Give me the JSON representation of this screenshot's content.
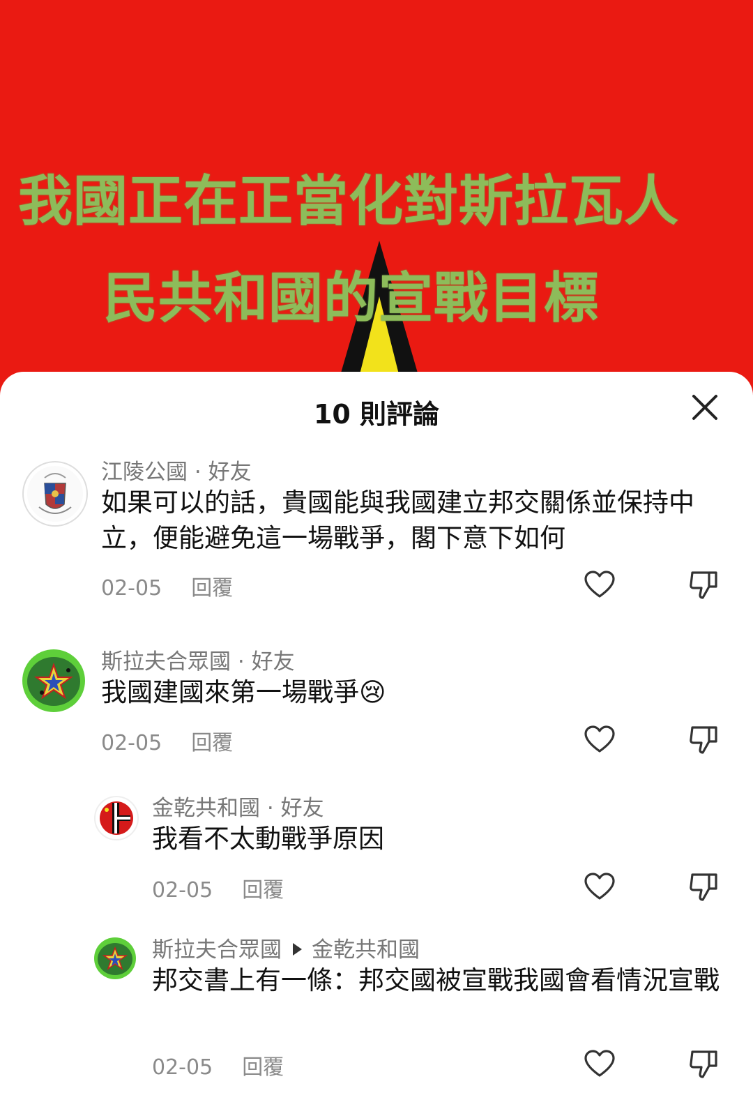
{
  "banner": {
    "line1": "我國正在正當化對斯拉瓦人",
    "line2": "民共和國的宣戰目標"
  },
  "sheet": {
    "title": "10 則評論"
  },
  "comments": [
    {
      "author": "江陵公國",
      "relation": "好友",
      "text": "如果可以的話，貴國能與我國建立邦交關係並保持中立，便能避免這一場戰爭，閣下意下如何",
      "date": "02-05",
      "reply_label": "回覆"
    },
    {
      "author": "斯拉夫合眾國",
      "relation": "好友",
      "text": "我國建國來第一場戰爭",
      "emoji": "😢",
      "date": "02-05",
      "reply_label": "回覆"
    },
    {
      "author": "金乾共和國",
      "relation": "好友",
      "text": "我看不太動戰爭原因",
      "date": "02-05",
      "reply_label": "回覆"
    },
    {
      "author": "斯拉夫合眾國",
      "reply_to": "金乾共和國",
      "text": "邦交書上有一條：邦交國被宣戰我國會看情況宣戰",
      "date": "02-05",
      "reply_label": "回覆"
    }
  ],
  "icons": {
    "close": "close-icon",
    "like": "heart-icon",
    "dislike": "thumbs-down-icon"
  },
  "colors": {
    "banner_bg": "#ea1a12",
    "banner_text": "#8dbc5a",
    "triangle_yellow": "#f2e21b",
    "avatar_green": "#5ecf3a"
  },
  "separator": "·"
}
